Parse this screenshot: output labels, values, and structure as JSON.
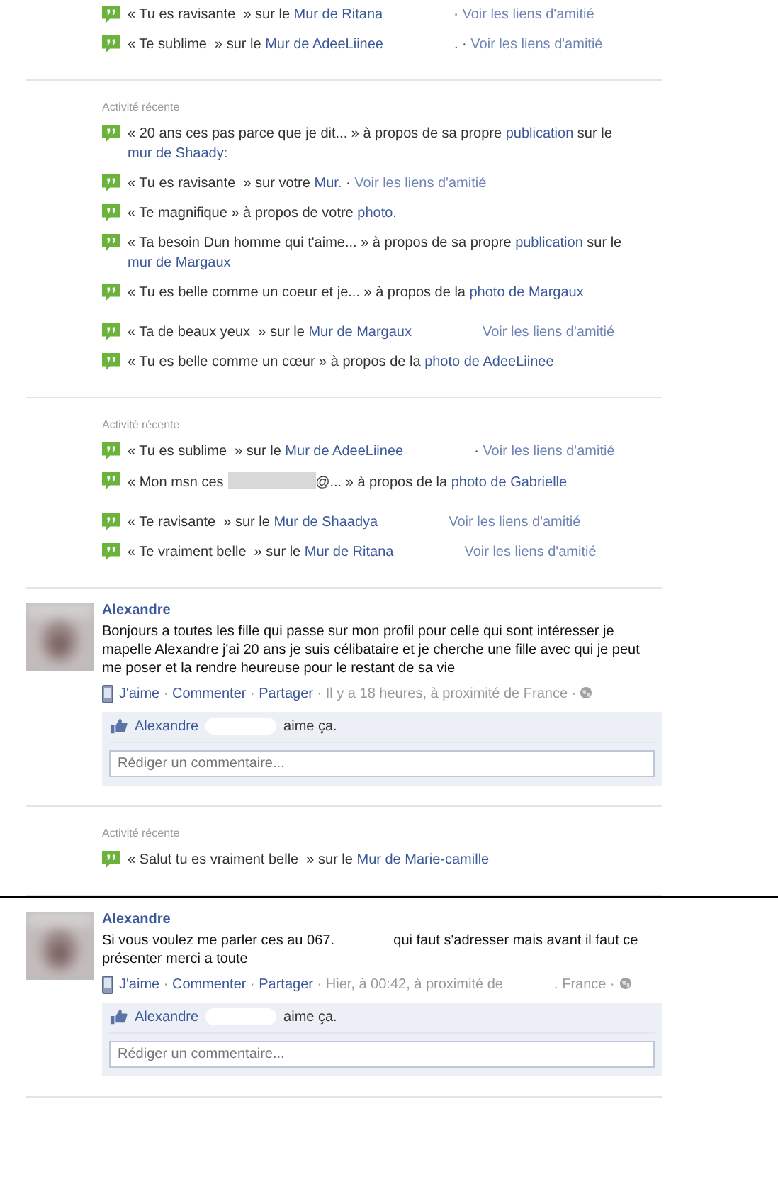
{
  "blocks": [
    {
      "kind": "activity",
      "groups": [
        {
          "items": [
            {
              "parts": [
                {
                  "kind": "text",
                  "t": "« Tu es ravisante  » sur le "
                },
                {
                  "kind": "link",
                  "t": "Mur de Ritana"
                },
                {
                  "kind": "gap"
                },
                {
                  "kind": "text",
                  "t": "· "
                },
                {
                  "kind": "muted_link",
                  "t": "Voir les liens d'amitié"
                }
              ]
            },
            {
              "parts": [
                {
                  "kind": "text",
                  "t": "« Te sublime  » sur le "
                },
                {
                  "kind": "link",
                  "t": "Mur de AdeeLiinee"
                },
                {
                  "kind": "gap"
                },
                {
                  "kind": "text",
                  "t": ". · "
                },
                {
                  "kind": "muted_link",
                  "t": "Voir les liens d'amitié"
                }
              ]
            }
          ]
        }
      ]
    },
    {
      "kind": "activity",
      "header": "Activité récente",
      "groups": [
        {
          "items": [
            {
              "parts": [
                {
                  "kind": "text",
                  "t": "« 20 ans ces pas parce que je dit... » à propos de sa propre "
                },
                {
                  "kind": "link",
                  "t": "publication"
                },
                {
                  "kind": "text",
                  "t": " sur le "
                },
                {
                  "kind": "link",
                  "t": "mur de Shaady:"
                }
              ]
            },
            {
              "parts": [
                {
                  "kind": "text",
                  "t": "« Tu es ravisante  » sur votre "
                },
                {
                  "kind": "link",
                  "t": "Mur."
                },
                {
                  "kind": "text",
                  "t": " · "
                },
                {
                  "kind": "muted_link",
                  "t": "Voir les liens d'amitié"
                }
              ]
            },
            {
              "parts": [
                {
                  "kind": "text",
                  "t": "« Te magnifique » à propos de votre "
                },
                {
                  "kind": "link",
                  "t": "photo."
                }
              ]
            },
            {
              "parts": [
                {
                  "kind": "text",
                  "t": "« Ta besoin Dun homme qui t'aime... » à propos de sa propre "
                },
                {
                  "kind": "link",
                  "t": "publication"
                },
                {
                  "kind": "text",
                  "t": " sur le "
                },
                {
                  "kind": "link",
                  "t": "mur de Margaux"
                }
              ]
            },
            {
              "parts": [
                {
                  "kind": "text",
                  "t": "« Tu es belle comme un coeur et je... » à propos de la "
                },
                {
                  "kind": "link",
                  "t": "photo de Margaux"
                }
              ]
            }
          ]
        },
        {
          "items": [
            {
              "parts": [
                {
                  "kind": "text",
                  "t": "« Ta de beaux yeux  » sur le "
                },
                {
                  "kind": "link",
                  "t": "Mur de Margaux"
                },
                {
                  "kind": "gap"
                },
                {
                  "kind": "muted_link",
                  "t": "Voir les liens d'amitié"
                }
              ]
            },
            {
              "parts": [
                {
                  "kind": "text",
                  "t": "« Tu es belle comme un cœur » à propos de la "
                },
                {
                  "kind": "link",
                  "t": "photo de AdeeLiinee"
                }
              ]
            }
          ]
        }
      ]
    },
    {
      "kind": "activity",
      "header": "Activité récente",
      "groups": [
        {
          "items": [
            {
              "parts": [
                {
                  "kind": "text",
                  "t": "« Tu es sublime  » sur le "
                },
                {
                  "kind": "link",
                  "t": "Mur de AdeeLiinee"
                },
                {
                  "kind": "gap"
                },
                {
                  "kind": "text",
                  "t": "· "
                },
                {
                  "kind": "muted_link",
                  "t": "Voir les liens d'amitié"
                }
              ]
            },
            {
              "parts": [
                {
                  "kind": "text",
                  "t": "« Mon msn ces "
                },
                {
                  "kind": "redacted"
                },
                {
                  "kind": "text",
                  "t": "@... » à propos de la "
                },
                {
                  "kind": "link",
                  "t": "photo de Gabrielle"
                }
              ]
            }
          ]
        },
        {
          "items": [
            {
              "parts": [
                {
                  "kind": "text",
                  "t": "« Te ravisante  » sur le "
                },
                {
                  "kind": "link",
                  "t": "Mur de Shaadya"
                },
                {
                  "kind": "gap"
                },
                {
                  "kind": "muted_link",
                  "t": "Voir les liens d'amitié"
                }
              ]
            },
            {
              "parts": [
                {
                  "kind": "text",
                  "t": "« Te vraiment belle  » sur le "
                },
                {
                  "kind": "link",
                  "t": "Mur de Ritana"
                },
                {
                  "kind": "gap"
                },
                {
                  "kind": "muted_link",
                  "t": "Voir les liens d'amitié"
                }
              ]
            }
          ]
        }
      ]
    },
    {
      "kind": "post",
      "author": "Alexandre",
      "body": "Bonjours a toutes les fille qui passe sur mon profil pour celle qui sont intéresser je mapelle Alexandre j'ai 20 ans je suis célibataire et je cherche une fille avec qui je peut me poser et la rendre heureuse pour le restant de sa vie",
      "meta": [
        {
          "kind": "link",
          "t": "J'aime"
        },
        {
          "kind": "text",
          "t": " · "
        },
        {
          "kind": "link",
          "t": "Commenter"
        },
        {
          "kind": "text",
          "t": " · "
        },
        {
          "kind": "link",
          "t": "Partager"
        },
        {
          "kind": "text",
          "t": " · Il y a 18 heures, à proximité de France · "
        }
      ],
      "liker": "Alexandre",
      "likes_text": "aime ça.",
      "comment_placeholder": "Rédiger un commentaire..."
    },
    {
      "kind": "activity",
      "header": "Activité récente",
      "groups": [
        {
          "items": [
            {
              "parts": [
                {
                  "kind": "text",
                  "t": "« Salut tu es vraiment belle  » sur le "
                },
                {
                  "kind": "link",
                  "t": "Mur de Marie-camille"
                }
              ]
            }
          ]
        }
      ]
    },
    {
      "kind": "separator"
    },
    {
      "kind": "post",
      "author": "Alexandre",
      "body": "Si vous voulez me parler ces au 067.               qui faut s'adresser mais avant il faut ce présenter merci a toute",
      "meta": [
        {
          "kind": "link",
          "t": "J'aime"
        },
        {
          "kind": "text",
          "t": " · "
        },
        {
          "kind": "link",
          "t": "Commenter"
        },
        {
          "kind": "text",
          "t": " · "
        },
        {
          "kind": "link",
          "t": "Partager"
        },
        {
          "kind": "text",
          "t": " · Hier, à 00:42, à proximité de             . France · "
        }
      ],
      "liker": "Alexandre",
      "likes_text": "aime ça.",
      "comment_placeholder": "Rédiger un commentaire..."
    }
  ]
}
